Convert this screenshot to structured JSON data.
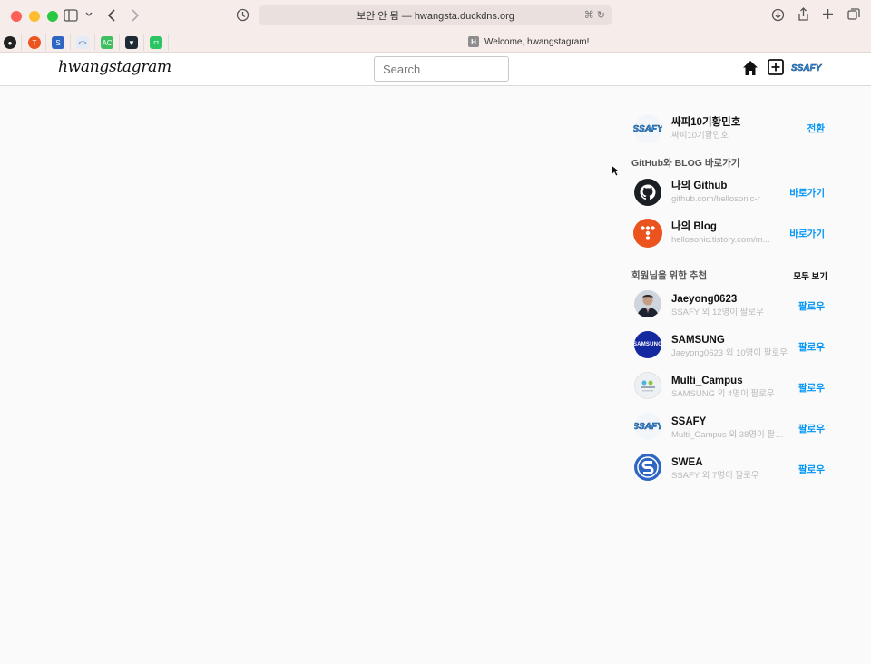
{
  "browser": {
    "url_text": "보안 안 됨 — hwangsta.duckdns.org",
    "tab_title": "Welcome, hwangstagram!",
    "tab_favicon": "H"
  },
  "app": {
    "logo_text": "hwangstagram",
    "search_placeholder": "Search"
  },
  "profile": {
    "name": "싸피10기황민호",
    "sub": "싸피10기황민호",
    "action": "전환"
  },
  "links_section": {
    "title": "GitHub와 BLOG 바로가기",
    "items": [
      {
        "name": "나의 Github",
        "sub": "github.com/hellosonic-r",
        "action": "바로가기",
        "icon": "github-icon"
      },
      {
        "name": "나의 Blog",
        "sub": "hellosonic.tistory.com/m...",
        "action": "바로가기",
        "icon": "tistory-icon"
      }
    ]
  },
  "recommend": {
    "title": "회원님을 위한 추천",
    "see_all": "모두 보기",
    "users": [
      {
        "name": "Jaeyong0623",
        "sub": "SSAFY 외 12명이 팔로우",
        "action": "팔로우",
        "avatar": "person-avatar"
      },
      {
        "name": "SAMSUNG",
        "sub": "Jaeyong0623 외 10명이 팔로우",
        "action": "팔로우",
        "avatar": "samsung-logo"
      },
      {
        "name": "Multi_Campus",
        "sub": "SAMSUNG 외 4명이 팔로우",
        "action": "팔로우",
        "avatar": "multicampus-logo"
      },
      {
        "name": "SSAFY",
        "sub": "Multi_Campus 외 38명이 팔로...",
        "action": "팔로우",
        "avatar": "ssafy-logo"
      },
      {
        "name": "SWEA",
        "sub": "SSAFY 외 7명이 팔로우",
        "action": "팔로우",
        "avatar": "swea-logo"
      }
    ]
  },
  "colors": {
    "accent": "#0095f6",
    "samsung": "#1428a0",
    "swea": "#2f66c4",
    "tistory": "#eb531f"
  }
}
